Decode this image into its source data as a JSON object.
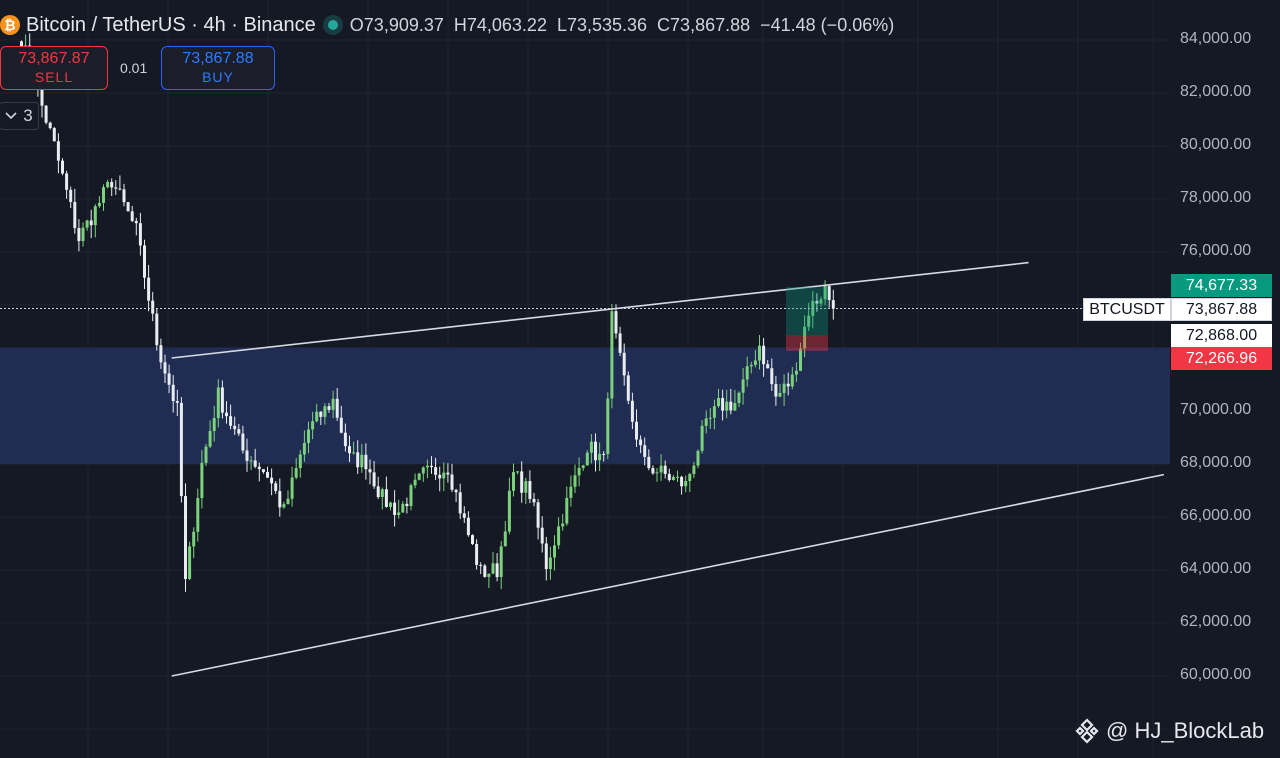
{
  "header": {
    "coin_glyph": "₿",
    "title": "Bitcoin / TetherUS · 4h · Binance",
    "open_label": "O",
    "open": "73,909.37",
    "high_label": "H",
    "high": "74,063.22",
    "low_label": "L",
    "low": "73,535.36",
    "close_label": "C",
    "close": "73,867.88",
    "change": "−41.48 (−0.06%)"
  },
  "trade": {
    "sell_price": "73,867.87",
    "sell_label": "SELL",
    "spread": "0.01",
    "buy_price": "73,867.88",
    "buy_label": "BUY"
  },
  "indicators": {
    "collapse_icon": "chevron-down",
    "count": "3"
  },
  "price_axis": {
    "labels": [
      "84,000.00",
      "82,000.00",
      "80,000.00",
      "78,000.00",
      "76,000.00",
      "70,000.00",
      "68,000.00",
      "66,000.00",
      "64,000.00",
      "62,000.00",
      "60,000.00"
    ],
    "symbol_tag": "BTCUSDT",
    "last_price": "73,867.88",
    "take_profit": "74,677.33",
    "entry": "72,868.00",
    "stop_loss": "72,266.96"
  },
  "watermark": {
    "text": "@ HJ_BlockLab",
    "icon": "binance-logo"
  },
  "colors": {
    "bull": "#7cd17c",
    "bear": "#e8edf2",
    "zone": "#223059",
    "profit": "#089981",
    "loss": "#f23645",
    "background": "#151924"
  },
  "chart_data": {
    "type": "candlestick",
    "title": "Bitcoin / TetherUS · 4h · Binance",
    "ylim": [
      58000,
      85000
    ],
    "y_ticks": [
      60000,
      62000,
      64000,
      66000,
      68000,
      70000,
      76000,
      78000,
      80000,
      82000,
      84000
    ],
    "grid": true,
    "close_path": [
      [
        0,
        84000
      ],
      [
        8,
        80000
      ],
      [
        14,
        76500
      ],
      [
        22,
        78700
      ],
      [
        28,
        76800
      ],
      [
        33,
        72600
      ],
      [
        38,
        70000
      ],
      [
        40,
        63500
      ],
      [
        44,
        68000
      ],
      [
        48,
        70600
      ],
      [
        54,
        68500
      ],
      [
        60,
        67600
      ],
      [
        64,
        66200
      ],
      [
        70,
        69300
      ],
      [
        76,
        70400
      ],
      [
        80,
        68200
      ],
      [
        84,
        68100
      ],
      [
        88,
        66700
      ],
      [
        92,
        66200
      ],
      [
        98,
        67600
      ],
      [
        104,
        67900
      ],
      [
        108,
        65800
      ],
      [
        112,
        63900
      ],
      [
        116,
        64000
      ],
      [
        120,
        67600
      ],
      [
        124,
        66900
      ],
      [
        128,
        64200
      ],
      [
        134,
        67000
      ],
      [
        138,
        68700
      ],
      [
        142,
        68100
      ],
      [
        144,
        73500
      ],
      [
        148,
        70200
      ],
      [
        152,
        68000
      ],
      [
        158,
        67500
      ],
      [
        162,
        67200
      ],
      [
        166,
        69100
      ],
      [
        170,
        70200
      ],
      [
        174,
        70300
      ],
      [
        176,
        71000
      ],
      [
        180,
        72500
      ],
      [
        184,
        70500
      ],
      [
        188,
        71200
      ],
      [
        192,
        73800
      ],
      [
        196,
        74600
      ],
      [
        198,
        73867.88
      ]
    ],
    "shapes": {
      "upper_trendline": [
        [
          37,
          72000
        ],
        [
          246,
          75600
        ]
      ],
      "lower_trendline": [
        [
          37,
          60000
        ],
        [
          279,
          67600
        ]
      ],
      "support_zone": [
        68000,
        72400
      ],
      "position_tool": {
        "take_profit": 74677.33,
        "entry": 72868.0,
        "stop_loss": 72266.96
      }
    }
  }
}
